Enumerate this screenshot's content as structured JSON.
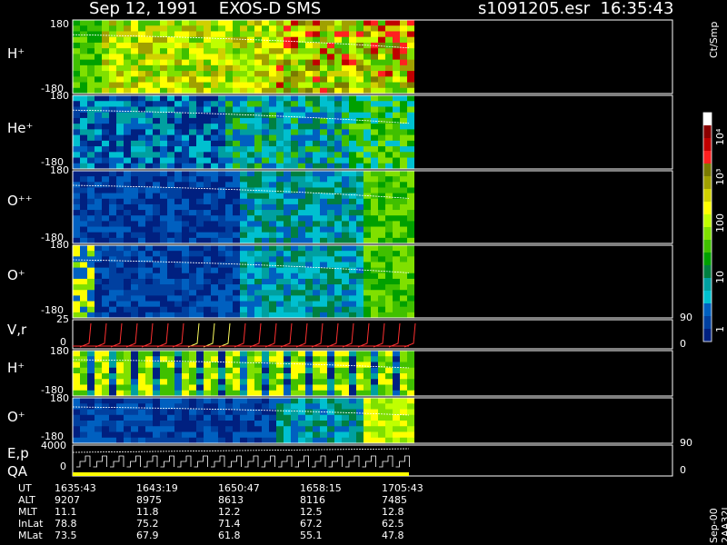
{
  "header": {
    "date_instrument": "Sep 12, 1991    EXOS-D SMS",
    "file_time": "s1091205.esr  16:35:43"
  },
  "panels": [
    {
      "label": "H⁺",
      "top_tick": "180",
      "bottom_tick": "-180",
      "kind": "pitch"
    },
    {
      "label": "He⁺",
      "top_tick": "180",
      "bottom_tick": "-180",
      "kind": "pitch"
    },
    {
      "label": "O⁺⁺",
      "top_tick": "180",
      "bottom_tick": "-180",
      "kind": "pitch"
    },
    {
      "label": "O⁺",
      "top_tick": "180",
      "bottom_tick": "-180",
      "kind": "pitch"
    },
    {
      "label": "V,r",
      "top_tick": "25",
      "bottom_tick": "0",
      "right_top": "90",
      "right_bottom": "0",
      "kind": "vr"
    },
    {
      "label": "H⁺",
      "top_tick": "180",
      "bottom_tick": "-180",
      "kind": "pitch2"
    },
    {
      "label": "O⁺",
      "top_tick": "180",
      "bottom_tick": "-180",
      "kind": "pitch2"
    },
    {
      "label": "E,p",
      "label2": "QA",
      "top_tick": "4000",
      "bottom_tick": "0",
      "right_top": "90",
      "right_bottom": "0",
      "kind": "ep"
    }
  ],
  "colorbar": {
    "unit": "Ct/Smp",
    "ticks": [
      "10⁴",
      "10³",
      "100",
      "10",
      "1"
    ],
    "colors": [
      "#ffffff",
      "#8b0000",
      "#c00000",
      "#ff2020",
      "#7a7a00",
      "#a0a000",
      "#d0d000",
      "#ffff00",
      "#c0ff00",
      "#80e000",
      "#40c000",
      "#00a000",
      "#008040",
      "#00a0a0",
      "#00c0d0",
      "#0060c0",
      "#0040a0",
      "#002080"
    ],
    "footer": "Sep-00  2AA32L"
  },
  "footer_table": {
    "rows": [
      {
        "label": "UT",
        "values": [
          "1635:43",
          "1643:19",
          "1650:47",
          "1658:15",
          "1705:43"
        ]
      },
      {
        "label": "ALT",
        "values": [
          "9207",
          "8975",
          "8613",
          "8116",
          "7485"
        ]
      },
      {
        "label": "MLT",
        "values": [
          "11.1",
          "11.8",
          "12.2",
          "12.5",
          "12.8"
        ]
      },
      {
        "label": "InLat",
        "values": [
          "78.8",
          "75.2",
          "71.4",
          "67.2",
          "62.5"
        ]
      },
      {
        "label": "MLat",
        "values": [
          "73.5",
          "67.9",
          "61.8",
          "55.1",
          "47.8"
        ]
      }
    ]
  },
  "chart_data": {
    "type": "heatmap",
    "title": "Sep 12, 1991    EXOS-D SMS",
    "x_ticks_ut": [
      "1635:43",
      "1643:19",
      "1650:47",
      "1658:15",
      "1705:43"
    ],
    "series": [
      {
        "name": "H⁺",
        "ylim": [
          -180,
          180
        ]
      },
      {
        "name": "He⁺",
        "ylim": [
          -180,
          180
        ]
      },
      {
        "name": "O⁺⁺",
        "ylim": [
          -180,
          180
        ]
      },
      {
        "name": "O⁺",
        "ylim": [
          -180,
          180
        ]
      },
      {
        "name": "V,r",
        "ylim": [
          0,
          25
        ],
        "y2lim": [
          0,
          90
        ]
      },
      {
        "name": "H⁺",
        "ylim": [
          -180,
          180
        ]
      },
      {
        "name": "O⁺",
        "ylim": [
          -180,
          180
        ]
      },
      {
        "name": "E,p",
        "ylim": [
          0,
          4000
        ],
        "y2lim": [
          0,
          90
        ]
      }
    ],
    "colorbar_scale": "log",
    "colorbar_range": [
      1,
      10000
    ]
  }
}
